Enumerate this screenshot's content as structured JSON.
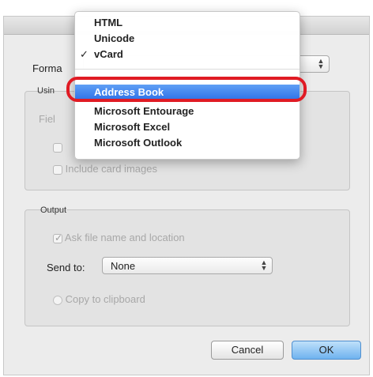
{
  "dialog": {
    "format_label": "Forma",
    "format_selected": "",
    "group1_label": "Usin",
    "field_label_partial": "Fiel",
    "checkbox1_label": "",
    "include_card_images_label": "Include card images",
    "output_label": "Output",
    "ask_file_label": "Ask file name and location",
    "send_to_label": "Send to:",
    "send_to_value": "None",
    "copy_clipboard_label": "Copy to clipboard",
    "cancel_label": "Cancel",
    "ok_label": "OK"
  },
  "menu": {
    "items": [
      {
        "label": "HTML",
        "checked": false
      },
      {
        "label": "Unicode",
        "checked": false
      },
      {
        "label": "vCard",
        "checked": true
      },
      {
        "label": "Address Book",
        "checked": false
      },
      {
        "label": "Microsoft Entourage",
        "checked": false
      },
      {
        "label": "Microsoft Excel",
        "checked": false
      },
      {
        "label": "Microsoft Outlook",
        "checked": false
      }
    ],
    "check_glyph": "✓",
    "highlighted": "Address Book"
  },
  "colors": {
    "highlight": "#2d71e8",
    "annotation": "#e01b24",
    "default_button": "#6fb3ef"
  }
}
